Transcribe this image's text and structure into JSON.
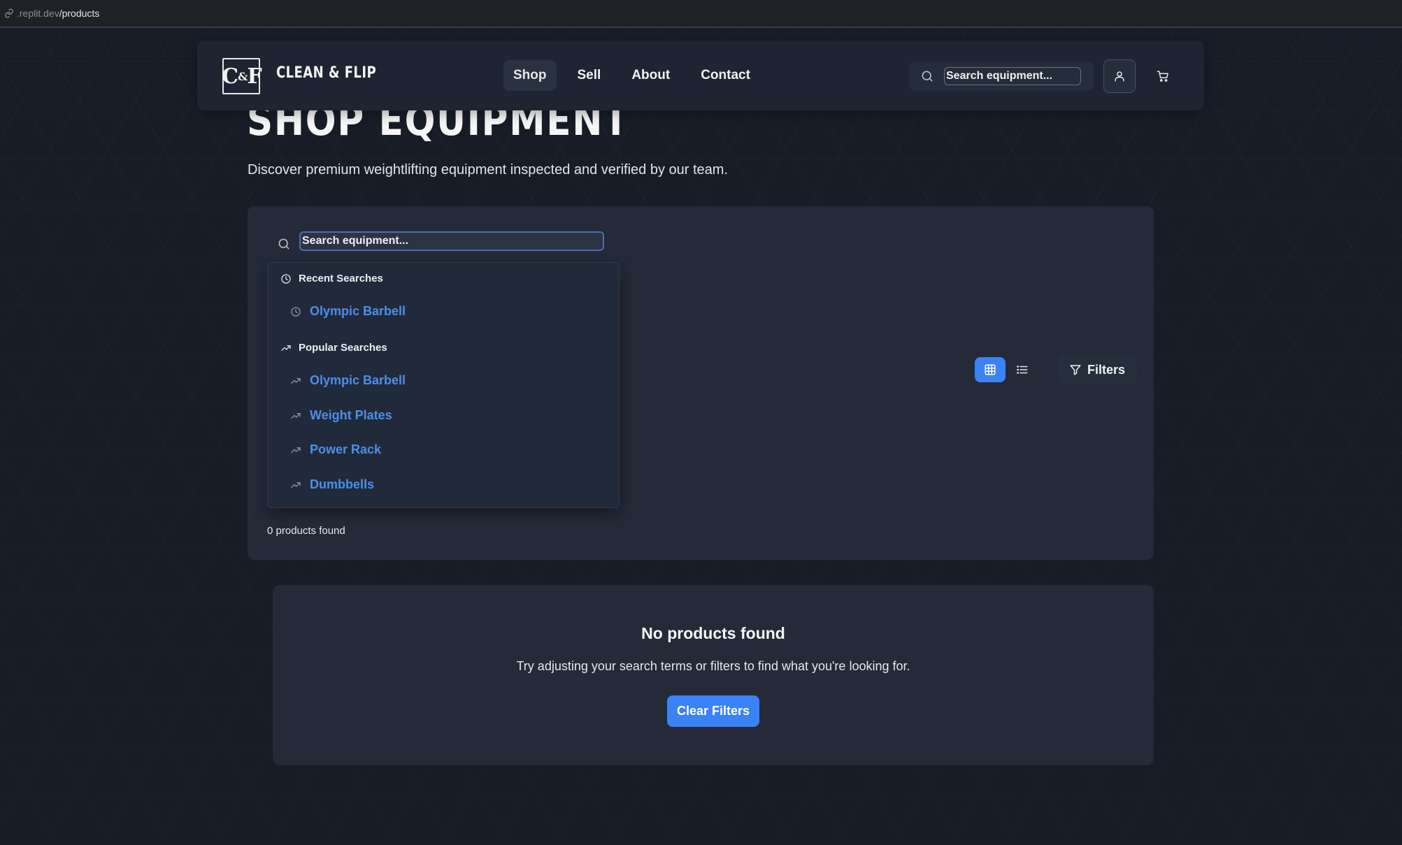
{
  "browser": {
    "url_domain": ".replit.dev",
    "url_path": "/products"
  },
  "header": {
    "logo_left": "C",
    "logo_amp": "&",
    "logo_right": "F",
    "brand": "CLEAN & FLIP",
    "nav": [
      {
        "label": "Shop",
        "active": true
      },
      {
        "label": "Sell",
        "active": false
      },
      {
        "label": "About",
        "active": false
      },
      {
        "label": "Contact",
        "active": false
      }
    ],
    "search_placeholder": "Search equipment..."
  },
  "page": {
    "title": "SHOP EQUIPMENT",
    "subtitle": "Discover premium weightlifting equipment inspected and verified by our team."
  },
  "filters": {
    "search_placeholder": "Search equipment...",
    "dropdown": {
      "recent_heading": "Recent Searches",
      "recent": [
        "Olympic Barbell"
      ],
      "popular_heading": "Popular Searches",
      "popular": [
        "Olympic Barbell",
        "Weight Plates",
        "Power Rack",
        "Dumbbells"
      ]
    },
    "filters_label": "Filters",
    "results_count": "0 products found"
  },
  "empty_state": {
    "title": "No products found",
    "message": "Try adjusting your search terms or filters to find what you're looking for.",
    "clear_label": "Clear Filters"
  },
  "colors": {
    "accent": "#3b82f6",
    "link": "#4e8ee8",
    "panel": "#242a38",
    "background": "#181d28"
  }
}
